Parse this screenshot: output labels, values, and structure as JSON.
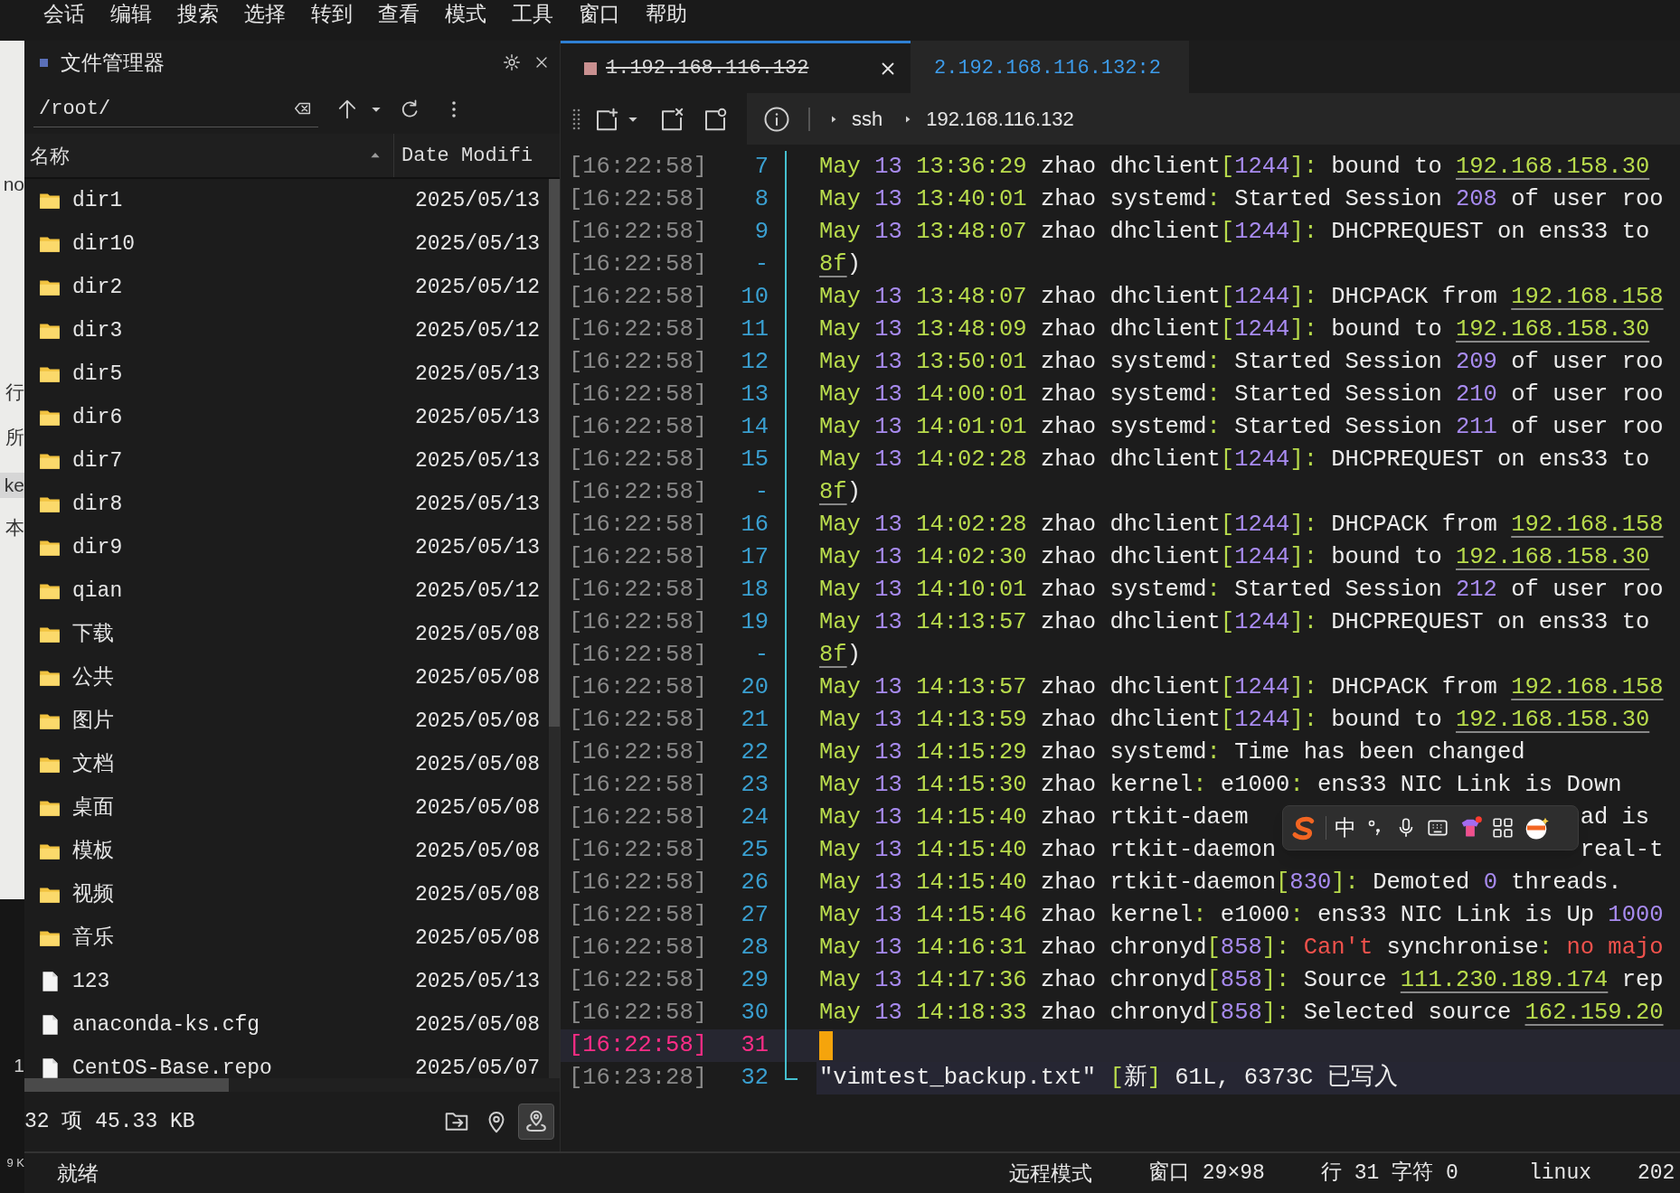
{
  "menu": [
    "会话",
    "编辑",
    "搜索",
    "选择",
    "转到",
    "查看",
    "模式",
    "工具",
    "窗口",
    "帮助"
  ],
  "background_window": {
    "fragments": [
      "no",
      "行",
      "所",
      "ke",
      "本",
      "1",
      "9 K"
    ]
  },
  "file_manager": {
    "title": "文件管理器",
    "path": "/root/",
    "columns": [
      {
        "label": "名称",
        "sorted": true
      },
      {
        "label": "Date Modifi",
        "sorted": false
      }
    ],
    "rows": [
      {
        "name": "dir1",
        "date": "2025/05/13",
        "kind": "folder"
      },
      {
        "name": "dir10",
        "date": "2025/05/13",
        "kind": "folder"
      },
      {
        "name": "dir2",
        "date": "2025/05/12",
        "kind": "folder"
      },
      {
        "name": "dir3",
        "date": "2025/05/12",
        "kind": "folder"
      },
      {
        "name": "dir5",
        "date": "2025/05/13",
        "kind": "folder"
      },
      {
        "name": "dir6",
        "date": "2025/05/13",
        "kind": "folder"
      },
      {
        "name": "dir7",
        "date": "2025/05/13",
        "kind": "folder"
      },
      {
        "name": "dir8",
        "date": "2025/05/13",
        "kind": "folder"
      },
      {
        "name": "dir9",
        "date": "2025/05/13",
        "kind": "folder"
      },
      {
        "name": "qian",
        "date": "2025/05/12",
        "kind": "folder"
      },
      {
        "name": "下载",
        "date": "2025/05/08",
        "kind": "folder"
      },
      {
        "name": "公共",
        "date": "2025/05/08",
        "kind": "folder"
      },
      {
        "name": "图片",
        "date": "2025/05/08",
        "kind": "folder"
      },
      {
        "name": "文档",
        "date": "2025/05/08",
        "kind": "folder"
      },
      {
        "name": "桌面",
        "date": "2025/05/08",
        "kind": "folder"
      },
      {
        "name": "模板",
        "date": "2025/05/08",
        "kind": "folder"
      },
      {
        "name": "视频",
        "date": "2025/05/08",
        "kind": "folder"
      },
      {
        "name": "音乐",
        "date": "2025/05/08",
        "kind": "folder"
      },
      {
        "name": "123",
        "date": "2025/05/13",
        "kind": "file"
      },
      {
        "name": "anaconda-ks.cfg",
        "date": "2025/05/08",
        "kind": "file"
      },
      {
        "name": "CentOS-Base.repo",
        "date": "2025/05/07",
        "kind": "file"
      }
    ],
    "summary": "32 项 45.33 KB",
    "footer_buttons": [
      {
        "kind": "open-folder",
        "selected": false
      },
      {
        "kind": "locate",
        "selected": false
      },
      {
        "kind": "route",
        "selected": true
      }
    ]
  },
  "terminal": {
    "tabs": [
      {
        "label": "1.192.168.116.132",
        "selected": true,
        "disconnected": true
      },
      {
        "label": "2.192.168.116.132:2",
        "selected": false,
        "disconnected": false
      }
    ],
    "breadcrumb": [
      "ssh",
      "192.168.116.132"
    ],
    "lines": [
      {
        "time": "[16:22:58]",
        "num": "7",
        "kind": "log",
        "current": false,
        "segments": [
          {
            "kind": "date",
            "text": "May"
          },
          {
            "kind": "num",
            "text": " 13"
          },
          {
            "kind": "date",
            "text": " 13:36:29"
          },
          {
            "kind": "text",
            "text": " zhao dhclient"
          },
          {
            "kind": "punct",
            "text": "["
          },
          {
            "kind": "num",
            "text": "1244"
          },
          {
            "kind": "punct",
            "text": "]:"
          },
          {
            "kind": "text",
            "text": " bound to "
          },
          {
            "kind": "link",
            "text": "192.168.158.30"
          }
        ]
      },
      {
        "time": "[16:22:58]",
        "num": "8",
        "kind": "log",
        "current": false,
        "segments": [
          {
            "kind": "date",
            "text": "May"
          },
          {
            "kind": "num",
            "text": " 13"
          },
          {
            "kind": "date",
            "text": " 13:40:01"
          },
          {
            "kind": "text",
            "text": " zhao systemd"
          },
          {
            "kind": "punct",
            "text": ":"
          },
          {
            "kind": "text",
            "text": " Started Session "
          },
          {
            "kind": "num",
            "text": "208"
          },
          {
            "kind": "text",
            "text": " of user roo"
          }
        ]
      },
      {
        "time": "[16:22:58]",
        "num": "9",
        "kind": "log",
        "current": false,
        "segments": [
          {
            "kind": "date",
            "text": "May"
          },
          {
            "kind": "num",
            "text": " 13"
          },
          {
            "kind": "date",
            "text": " 13:48:07"
          },
          {
            "kind": "text",
            "text": " zhao dhclient"
          },
          {
            "kind": "punct",
            "text": "["
          },
          {
            "kind": "num",
            "text": "1244"
          },
          {
            "kind": "punct",
            "text": "]:"
          },
          {
            "kind": "text",
            "text": " DHCPREQUEST on ens33 to"
          }
        ]
      },
      {
        "time": "[16:22:58]",
        "num": "-",
        "kind": "log",
        "current": false,
        "segments": [
          {
            "kind": "link",
            "text": "8f"
          },
          {
            "kind": "text",
            "text": ")"
          }
        ]
      },
      {
        "time": "[16:22:58]",
        "num": "10",
        "kind": "log",
        "current": false,
        "segments": [
          {
            "kind": "date",
            "text": "May"
          },
          {
            "kind": "num",
            "text": " 13"
          },
          {
            "kind": "date",
            "text": " 13:48:07"
          },
          {
            "kind": "text",
            "text": " zhao dhclient"
          },
          {
            "kind": "punct",
            "text": "["
          },
          {
            "kind": "num",
            "text": "1244"
          },
          {
            "kind": "punct",
            "text": "]:"
          },
          {
            "kind": "text",
            "text": " DHCPACK from "
          },
          {
            "kind": "link",
            "text": "192.168.158"
          }
        ]
      },
      {
        "time": "[16:22:58]",
        "num": "11",
        "kind": "log",
        "current": false,
        "segments": [
          {
            "kind": "date",
            "text": "May"
          },
          {
            "kind": "num",
            "text": " 13"
          },
          {
            "kind": "date",
            "text": " 13:48:09"
          },
          {
            "kind": "text",
            "text": " zhao dhclient"
          },
          {
            "kind": "punct",
            "text": "["
          },
          {
            "kind": "num",
            "text": "1244"
          },
          {
            "kind": "punct",
            "text": "]:"
          },
          {
            "kind": "text",
            "text": " bound to "
          },
          {
            "kind": "link",
            "text": "192.168.158.30"
          }
        ]
      },
      {
        "time": "[16:22:58]",
        "num": "12",
        "kind": "log",
        "current": false,
        "segments": [
          {
            "kind": "date",
            "text": "May"
          },
          {
            "kind": "num",
            "text": " 13"
          },
          {
            "kind": "date",
            "text": " 13:50:01"
          },
          {
            "kind": "text",
            "text": " zhao systemd"
          },
          {
            "kind": "punct",
            "text": ":"
          },
          {
            "kind": "text",
            "text": " Started Session "
          },
          {
            "kind": "num",
            "text": "209"
          },
          {
            "kind": "text",
            "text": " of user roo"
          }
        ]
      },
      {
        "time": "[16:22:58]",
        "num": "13",
        "kind": "log",
        "current": false,
        "segments": [
          {
            "kind": "date",
            "text": "May"
          },
          {
            "kind": "num",
            "text": " 13"
          },
          {
            "kind": "date",
            "text": " 14:00:01"
          },
          {
            "kind": "text",
            "text": " zhao systemd"
          },
          {
            "kind": "punct",
            "text": ":"
          },
          {
            "kind": "text",
            "text": " Started Session "
          },
          {
            "kind": "num",
            "text": "210"
          },
          {
            "kind": "text",
            "text": " of user roo"
          }
        ]
      },
      {
        "time": "[16:22:58]",
        "num": "14",
        "kind": "log",
        "current": false,
        "segments": [
          {
            "kind": "date",
            "text": "May"
          },
          {
            "kind": "num",
            "text": " 13"
          },
          {
            "kind": "date",
            "text": " 14:01:01"
          },
          {
            "kind": "text",
            "text": " zhao systemd"
          },
          {
            "kind": "punct",
            "text": ":"
          },
          {
            "kind": "text",
            "text": " Started Session "
          },
          {
            "kind": "num",
            "text": "211"
          },
          {
            "kind": "text",
            "text": " of user roo"
          }
        ]
      },
      {
        "time": "[16:22:58]",
        "num": "15",
        "kind": "log",
        "current": false,
        "segments": [
          {
            "kind": "date",
            "text": "May"
          },
          {
            "kind": "num",
            "text": " 13"
          },
          {
            "kind": "date",
            "text": " 14:02:28"
          },
          {
            "kind": "text",
            "text": " zhao dhclient"
          },
          {
            "kind": "punct",
            "text": "["
          },
          {
            "kind": "num",
            "text": "1244"
          },
          {
            "kind": "punct",
            "text": "]:"
          },
          {
            "kind": "text",
            "text": " DHCPREQUEST on ens33 to"
          }
        ]
      },
      {
        "time": "[16:22:58]",
        "num": "-",
        "kind": "log",
        "current": false,
        "segments": [
          {
            "kind": "link",
            "text": "8f"
          },
          {
            "kind": "text",
            "text": ")"
          }
        ]
      },
      {
        "time": "[16:22:58]",
        "num": "16",
        "kind": "log",
        "current": false,
        "segments": [
          {
            "kind": "date",
            "text": "May"
          },
          {
            "kind": "num",
            "text": " 13"
          },
          {
            "kind": "date",
            "text": " 14:02:28"
          },
          {
            "kind": "text",
            "text": " zhao dhclient"
          },
          {
            "kind": "punct",
            "text": "["
          },
          {
            "kind": "num",
            "text": "1244"
          },
          {
            "kind": "punct",
            "text": "]:"
          },
          {
            "kind": "text",
            "text": " DHCPACK from "
          },
          {
            "kind": "link",
            "text": "192.168.158"
          }
        ]
      },
      {
        "time": "[16:22:58]",
        "num": "17",
        "kind": "log",
        "current": false,
        "segments": [
          {
            "kind": "date",
            "text": "May"
          },
          {
            "kind": "num",
            "text": " 13"
          },
          {
            "kind": "date",
            "text": " 14:02:30"
          },
          {
            "kind": "text",
            "text": " zhao dhclient"
          },
          {
            "kind": "punct",
            "text": "["
          },
          {
            "kind": "num",
            "text": "1244"
          },
          {
            "kind": "punct",
            "text": "]:"
          },
          {
            "kind": "text",
            "text": " bound to "
          },
          {
            "kind": "link",
            "text": "192.168.158.30"
          }
        ]
      },
      {
        "time": "[16:22:58]",
        "num": "18",
        "kind": "log",
        "current": false,
        "segments": [
          {
            "kind": "date",
            "text": "May"
          },
          {
            "kind": "num",
            "text": " 13"
          },
          {
            "kind": "date",
            "text": " 14:10:01"
          },
          {
            "kind": "text",
            "text": " zhao systemd"
          },
          {
            "kind": "punct",
            "text": ":"
          },
          {
            "kind": "text",
            "text": " Started Session "
          },
          {
            "kind": "num",
            "text": "212"
          },
          {
            "kind": "text",
            "text": " of user roo"
          }
        ]
      },
      {
        "time": "[16:22:58]",
        "num": "19",
        "kind": "log",
        "current": false,
        "segments": [
          {
            "kind": "date",
            "text": "May"
          },
          {
            "kind": "num",
            "text": " 13"
          },
          {
            "kind": "date",
            "text": " 14:13:57"
          },
          {
            "kind": "text",
            "text": " zhao dhclient"
          },
          {
            "kind": "punct",
            "text": "["
          },
          {
            "kind": "num",
            "text": "1244"
          },
          {
            "kind": "punct",
            "text": "]:"
          },
          {
            "kind": "text",
            "text": " DHCPREQUEST on ens33 to"
          }
        ]
      },
      {
        "time": "[16:22:58]",
        "num": "-",
        "kind": "log",
        "current": false,
        "segments": [
          {
            "kind": "link",
            "text": "8f"
          },
          {
            "kind": "text",
            "text": ")"
          }
        ]
      },
      {
        "time": "[16:22:58]",
        "num": "20",
        "kind": "log",
        "current": false,
        "segments": [
          {
            "kind": "date",
            "text": "May"
          },
          {
            "kind": "num",
            "text": " 13"
          },
          {
            "kind": "date",
            "text": " 14:13:57"
          },
          {
            "kind": "text",
            "text": " zhao dhclient"
          },
          {
            "kind": "punct",
            "text": "["
          },
          {
            "kind": "num",
            "text": "1244"
          },
          {
            "kind": "punct",
            "text": "]:"
          },
          {
            "kind": "text",
            "text": " DHCPACK from "
          },
          {
            "kind": "link",
            "text": "192.168.158"
          }
        ]
      },
      {
        "time": "[16:22:58]",
        "num": "21",
        "kind": "log",
        "current": false,
        "segments": [
          {
            "kind": "date",
            "text": "May"
          },
          {
            "kind": "num",
            "text": " 13"
          },
          {
            "kind": "date",
            "text": " 14:13:59"
          },
          {
            "kind": "text",
            "text": " zhao dhclient"
          },
          {
            "kind": "punct",
            "text": "["
          },
          {
            "kind": "num",
            "text": "1244"
          },
          {
            "kind": "punct",
            "text": "]:"
          },
          {
            "kind": "text",
            "text": " bound to "
          },
          {
            "kind": "link",
            "text": "192.168.158.30"
          }
        ]
      },
      {
        "time": "[16:22:58]",
        "num": "22",
        "kind": "log",
        "current": false,
        "segments": [
          {
            "kind": "date",
            "text": "May"
          },
          {
            "kind": "num",
            "text": " 13"
          },
          {
            "kind": "date",
            "text": " 14:15:29"
          },
          {
            "kind": "text",
            "text": " zhao systemd"
          },
          {
            "kind": "punct",
            "text": ":"
          },
          {
            "kind": "text",
            "text": " Time has been changed"
          }
        ]
      },
      {
        "time": "[16:22:58]",
        "num": "23",
        "kind": "log",
        "current": false,
        "segments": [
          {
            "kind": "date",
            "text": "May"
          },
          {
            "kind": "num",
            "text": " 13"
          },
          {
            "kind": "date",
            "text": " 14:15:30"
          },
          {
            "kind": "text",
            "text": " zhao kernel"
          },
          {
            "kind": "punct",
            "text": ":"
          },
          {
            "kind": "text",
            "text": " e1000"
          },
          {
            "kind": "punct",
            "text": ":"
          },
          {
            "kind": "text",
            "text": " ens33 NIC Link is Down"
          }
        ]
      },
      {
        "time": "[16:22:58]",
        "num": "24",
        "kind": "log",
        "current": false,
        "segments": [
          {
            "kind": "date",
            "text": "May"
          },
          {
            "kind": "num",
            "text": " 13"
          },
          {
            "kind": "date",
            "text": " 14:15:40"
          },
          {
            "kind": "text",
            "text": " zhao rtkit-daem"
          }
        ],
        "tail": "ad is"
      },
      {
        "time": "[16:22:58]",
        "num": "25",
        "kind": "log",
        "current": false,
        "segments": [
          {
            "kind": "date",
            "text": "May"
          },
          {
            "kind": "num",
            "text": " 13"
          },
          {
            "kind": "date",
            "text": " 14:15:40"
          },
          {
            "kind": "text",
            "text": " zhao rtkit-daemon"
          }
        ],
        "tail": "real-t"
      },
      {
        "time": "[16:22:58]",
        "num": "26",
        "kind": "log",
        "current": false,
        "segments": [
          {
            "kind": "date",
            "text": "May"
          },
          {
            "kind": "num",
            "text": " 13"
          },
          {
            "kind": "date",
            "text": " 14:15:40"
          },
          {
            "kind": "text",
            "text": " zhao rtkit-daemon"
          },
          {
            "kind": "punct",
            "text": "["
          },
          {
            "kind": "num",
            "text": "830"
          },
          {
            "kind": "punct",
            "text": "]:"
          },
          {
            "kind": "text",
            "text": " Demoted "
          },
          {
            "kind": "num",
            "text": "0"
          },
          {
            "kind": "text",
            "text": " threads."
          }
        ]
      },
      {
        "time": "[16:22:58]",
        "num": "27",
        "kind": "log",
        "current": false,
        "segments": [
          {
            "kind": "date",
            "text": "May"
          },
          {
            "kind": "num",
            "text": " 13"
          },
          {
            "kind": "date",
            "text": " 14:15:46"
          },
          {
            "kind": "text",
            "text": " zhao kernel"
          },
          {
            "kind": "punct",
            "text": ":"
          },
          {
            "kind": "text",
            "text": " e1000"
          },
          {
            "kind": "punct",
            "text": ":"
          },
          {
            "kind": "text",
            "text": " ens33 NIC Link is Up "
          },
          {
            "kind": "num",
            "text": "1000"
          }
        ]
      },
      {
        "time": "[16:22:58]",
        "num": "28",
        "kind": "log",
        "current": false,
        "segments": [
          {
            "kind": "date",
            "text": "May"
          },
          {
            "kind": "num",
            "text": " 13"
          },
          {
            "kind": "date",
            "text": " 14:16:31"
          },
          {
            "kind": "text",
            "text": " zhao chronyd"
          },
          {
            "kind": "punct",
            "text": "["
          },
          {
            "kind": "num",
            "text": "858"
          },
          {
            "kind": "punct",
            "text": "]:"
          },
          {
            "kind": "error",
            "text": " Can't"
          },
          {
            "kind": "text",
            "text": " synchronise"
          },
          {
            "kind": "punct",
            "text": ":"
          },
          {
            "kind": "error",
            "text": " no majo"
          }
        ]
      },
      {
        "time": "[16:22:58]",
        "num": "29",
        "kind": "log",
        "current": false,
        "segments": [
          {
            "kind": "date",
            "text": "May"
          },
          {
            "kind": "num",
            "text": " 13"
          },
          {
            "kind": "date",
            "text": " 14:17:36"
          },
          {
            "kind": "text",
            "text": " zhao chronyd"
          },
          {
            "kind": "punct",
            "text": "["
          },
          {
            "kind": "num",
            "text": "858"
          },
          {
            "kind": "punct",
            "text": "]:"
          },
          {
            "kind": "text",
            "text": " Source "
          },
          {
            "kind": "link",
            "text": "111.230.189.174"
          },
          {
            "kind": "text",
            "text": " rep"
          }
        ]
      },
      {
        "time": "[16:22:58]",
        "num": "30",
        "kind": "log",
        "current": false,
        "segments": [
          {
            "kind": "date",
            "text": "May"
          },
          {
            "kind": "num",
            "text": " 13"
          },
          {
            "kind": "date",
            "text": " 14:18:33"
          },
          {
            "kind": "text",
            "text": " zhao chronyd"
          },
          {
            "kind": "punct",
            "text": "["
          },
          {
            "kind": "num",
            "text": "858"
          },
          {
            "kind": "punct",
            "text": "]:"
          },
          {
            "kind": "text",
            "text": " Selected source "
          },
          {
            "kind": "link",
            "text": "162.159.20"
          }
        ]
      },
      {
        "time": "[16:22:58]",
        "num": "31",
        "kind": "cursor",
        "current": true
      },
      {
        "time": "[16:23:28]",
        "num": "32",
        "kind": "message",
        "current": false,
        "segments": [
          {
            "kind": "text",
            "text": "\"vimtest_backup.txt\" "
          },
          {
            "kind": "punct",
            "text": "["
          },
          {
            "kind": "text",
            "text": "新"
          },
          {
            "kind": "punct",
            "text": "]"
          },
          {
            "kind": "text",
            "text": " 61L, 6373C 已写入"
          }
        ]
      }
    ]
  },
  "ime_toolbar": {
    "label": "中"
  },
  "status_bar": {
    "left": "就绪",
    "items": [
      "远程模式",
      "窗口 29×98",
      "行 31 字符 0",
      "linux",
      "202"
    ]
  }
}
